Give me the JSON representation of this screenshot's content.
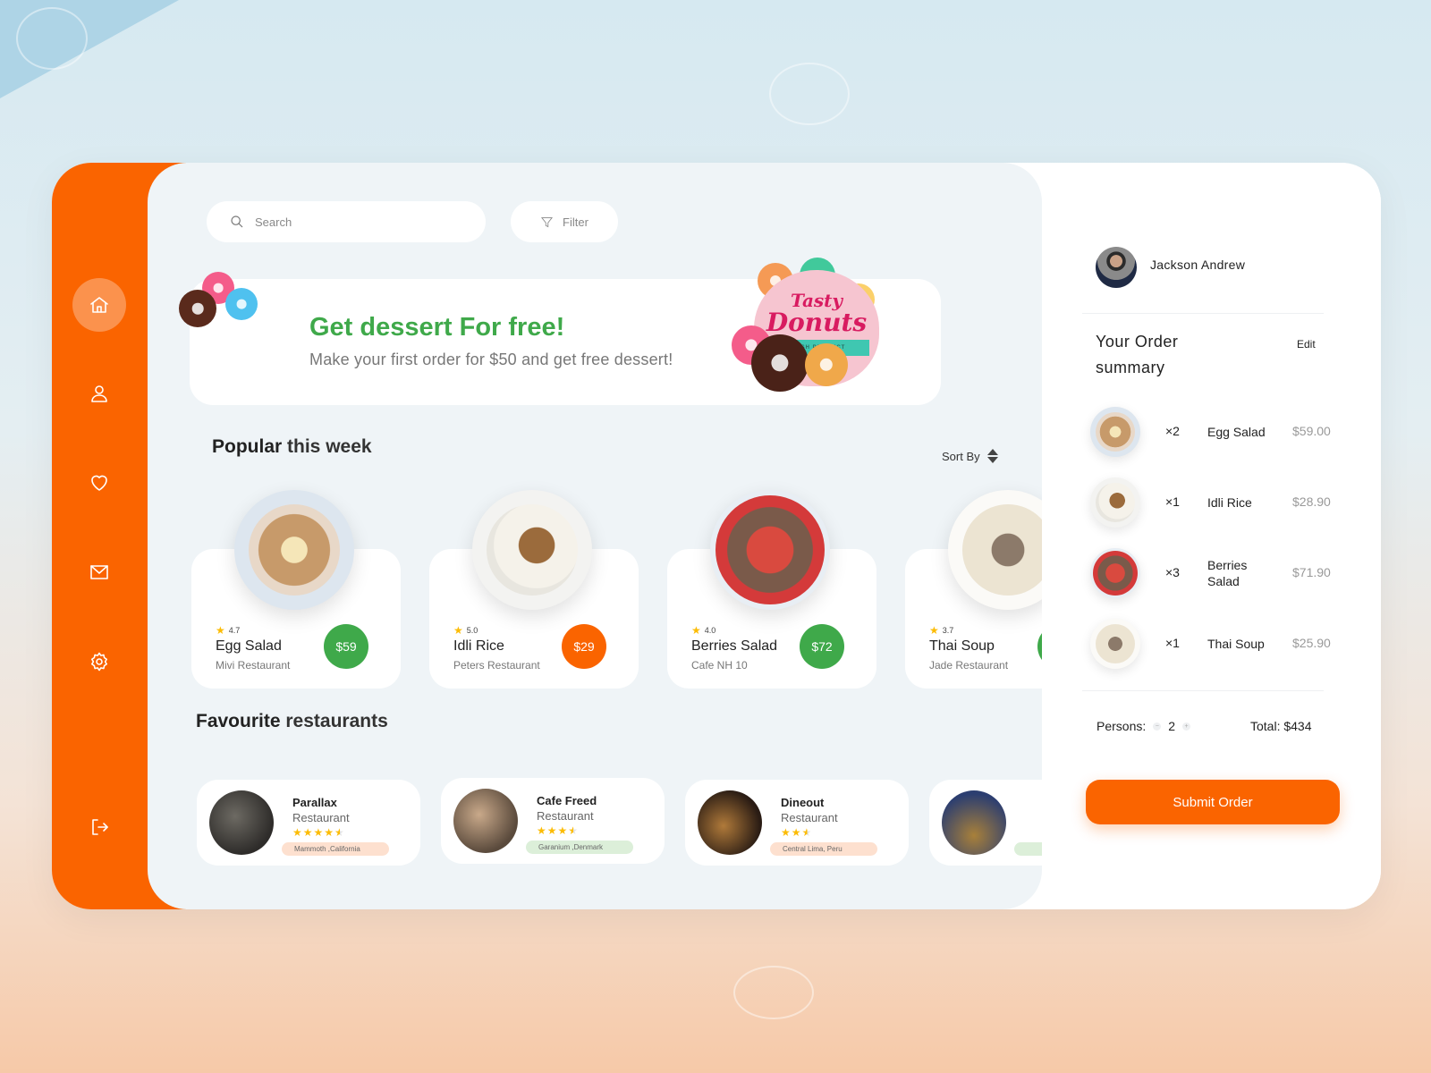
{
  "colors": {
    "brand_orange": "#fa6400",
    "green": "#3fa94a",
    "star": "#fcbc05"
  },
  "sidebar": {
    "items": [
      {
        "name": "home",
        "icon": "home-icon",
        "active": true
      },
      {
        "name": "profile",
        "icon": "user-icon",
        "active": false
      },
      {
        "name": "favourites",
        "icon": "heart-icon",
        "active": false
      },
      {
        "name": "messages",
        "icon": "mail-icon",
        "active": false
      },
      {
        "name": "settings",
        "icon": "gear-icon",
        "active": false
      }
    ],
    "logout_icon": "logout-icon"
  },
  "search": {
    "placeholder": "Search",
    "value": ""
  },
  "filter": {
    "label": "Filter"
  },
  "promo": {
    "title": "Get dessert For free!",
    "subtitle": "Make your first order for $50 and get free dessert!",
    "badge_line1": "Tasty",
    "badge_line2": "Donuts",
    "badge_band": "FRESH PRODUCT"
  },
  "popular": {
    "title_bold": "Popular",
    "title_rest": " this week",
    "sort_label": "Sort By",
    "items": [
      {
        "rating": "4.7",
        "name": "Egg Salad",
        "restaurant": "Mivi Restaurant",
        "price": "$59",
        "price_color": "#3fa94a"
      },
      {
        "rating": "5.0",
        "name": "Idli Rice",
        "restaurant": "Peters Restaurant",
        "price": "$29",
        "price_color": "#fa6400"
      },
      {
        "rating": "4.0",
        "name": "Berries Salad",
        "restaurant": "Cafe NH 10",
        "price": "$72",
        "price_color": "#3fa94a"
      },
      {
        "rating": "3.7",
        "name": "Thai Soup",
        "restaurant": "Jade Restaurant",
        "price": "",
        "price_color": "#3fa94a"
      }
    ]
  },
  "favourites": {
    "title_bold": "Favourite",
    "title_rest": " restaurants",
    "items": [
      {
        "name": "Parallax",
        "type": "Restaurant",
        "stars": 4.5,
        "location": "Mammoth ,California",
        "tag_color": "#fde0cf"
      },
      {
        "name": "Cafe Freed",
        "type": "Restaurant",
        "stars": 3.5,
        "location": "Garanium ,Denmark",
        "tag_color": "#dcefd9"
      },
      {
        "name": "Dineout",
        "type": "Restaurant",
        "stars": 2.5,
        "location": "Central Lima, Peru",
        "tag_color": "#fde0cf"
      },
      {
        "name": "",
        "type": "",
        "stars": 0,
        "location": "",
        "tag_color": "#dcefd9"
      }
    ]
  },
  "order": {
    "user_name": "Jackson Andrew",
    "title": "Your Order summary",
    "edit_label": "Edit",
    "items": [
      {
        "qty": "×2",
        "name": "Egg Salad",
        "price": "$59.00"
      },
      {
        "qty": "×1",
        "name": "Idli Rice",
        "price": "$28.90"
      },
      {
        "qty": "×3",
        "name": "Berries Salad",
        "price": "$71.90"
      },
      {
        "qty": "×1",
        "name": "Thai Soup",
        "price": "$25.90"
      }
    ],
    "persons_label": "Persons:",
    "persons_value": "2",
    "minus": "−",
    "plus": "+",
    "total_label": "Total: $434",
    "submit_label": "Submit Order"
  }
}
